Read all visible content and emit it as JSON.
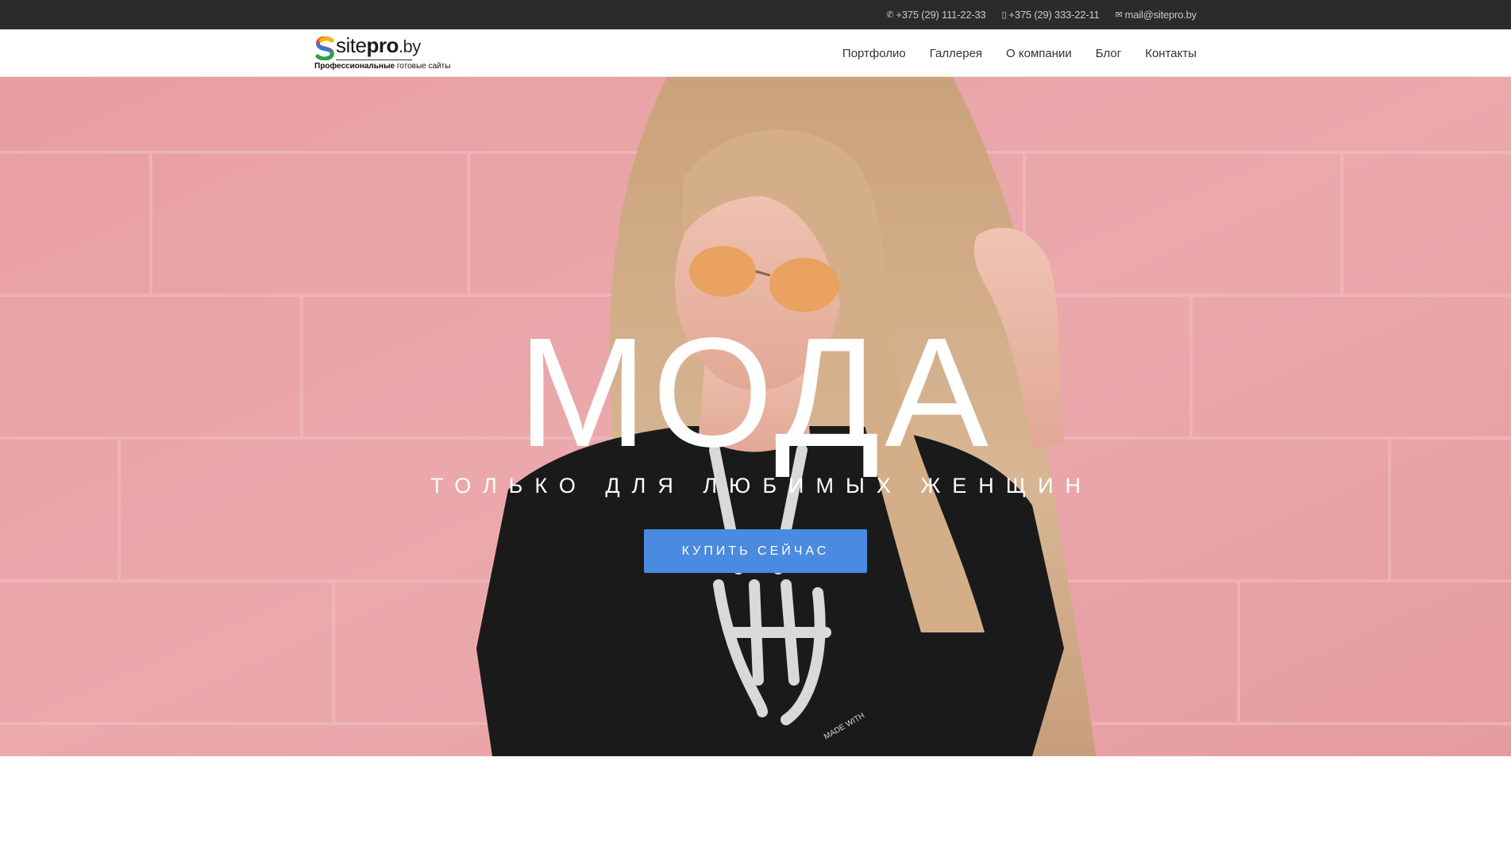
{
  "topbar": {
    "phone1": "+375 (29) 111-22-33",
    "phone2": "+375 (29) 333-22-11",
    "email": "mail@sitepro.by",
    "phone1_icon": "phone-icon",
    "phone2_icon": "mobile-icon",
    "email_icon": "envelope-icon"
  },
  "logo": {
    "site": "site",
    "pro": "pro",
    "domain": ".by",
    "tagline_bold": "Профессиональные",
    "tagline_rest": " готовые сайты"
  },
  "nav": {
    "items": [
      {
        "label": "Портфолио"
      },
      {
        "label": "Галлерея"
      },
      {
        "label": "О компании"
      },
      {
        "label": "Блог"
      },
      {
        "label": "Контакты"
      }
    ]
  },
  "hero": {
    "title": "МОДА",
    "subtitle": "ТОЛЬКО ДЛЯ ЛЮБИМЫХ ЖЕНЩИН",
    "button_label": "КУПИТЬ СЕЙЧАС",
    "shirt_print": "MADE WITH"
  },
  "colors": {
    "topbar_bg": "#2b2b2b",
    "wall_pink": "#e8a3a6",
    "button_blue": "#4a8ae0",
    "text_white": "#ffffff"
  }
}
